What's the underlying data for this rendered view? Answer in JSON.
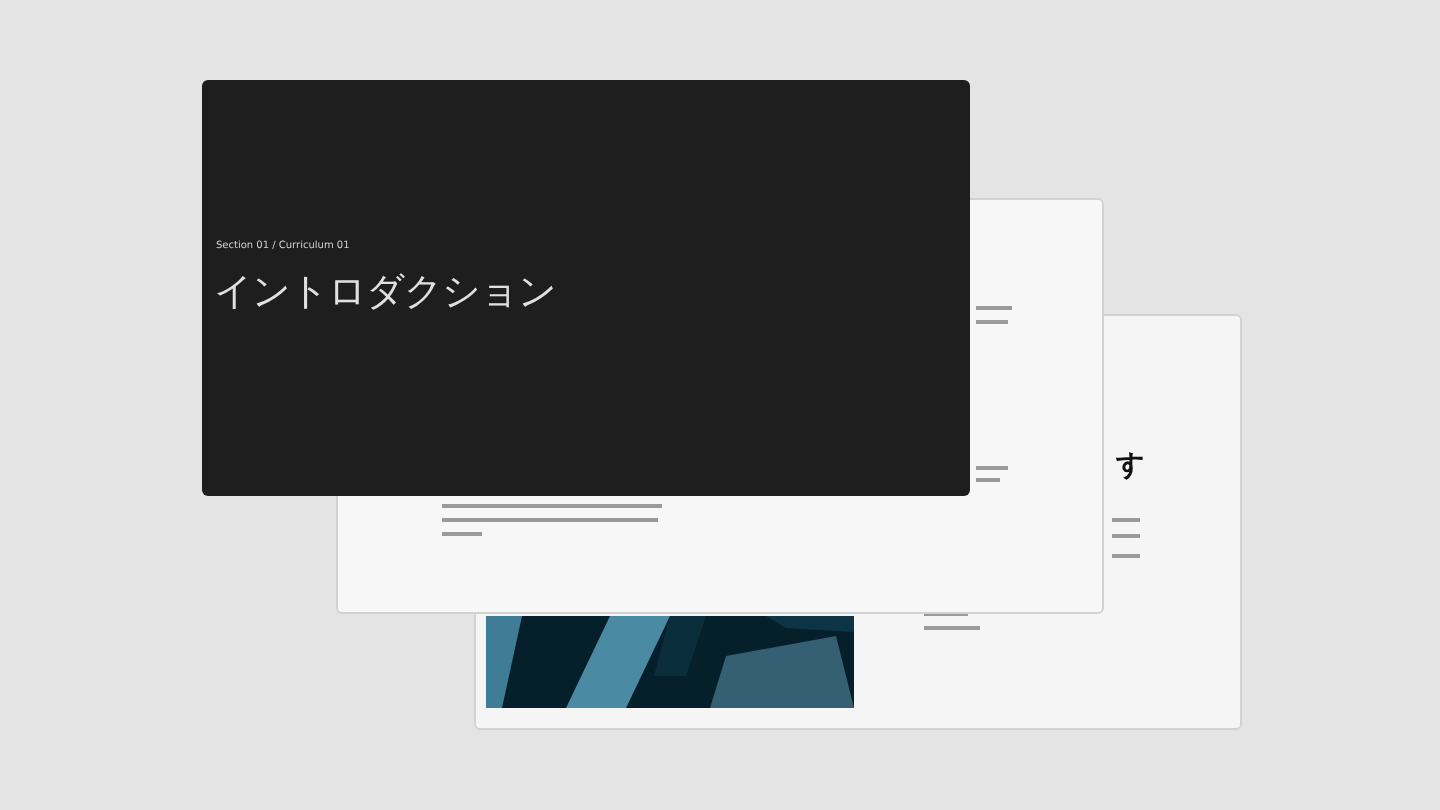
{
  "slides": [
    {
      "kind": "back",
      "heading": "す"
    },
    {
      "kind": "middle"
    },
    {
      "kind": "front",
      "eyebrow": "Section 01 / Curriculum 01",
      "title": "イントロダクション"
    }
  ]
}
